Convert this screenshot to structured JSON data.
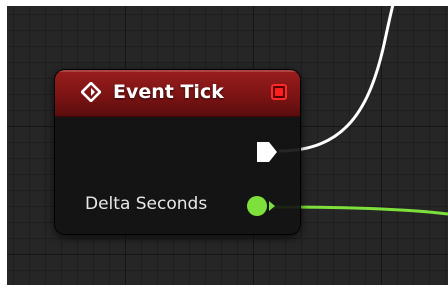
{
  "node": {
    "title": "Event Tick",
    "header_color": "#8b1515",
    "icon": "event-diamond-icon",
    "delegate_pin_icon": "delegate-square-icon",
    "exec_output_icon": "exec-arrow-icon",
    "outputs": [
      {
        "label": "Delta Seconds",
        "type_color": "#7ee03a",
        "icon": "float-pin-icon"
      }
    ]
  },
  "wires": {
    "exec_color": "#ffffff",
    "float_color": "#7ee03a"
  }
}
